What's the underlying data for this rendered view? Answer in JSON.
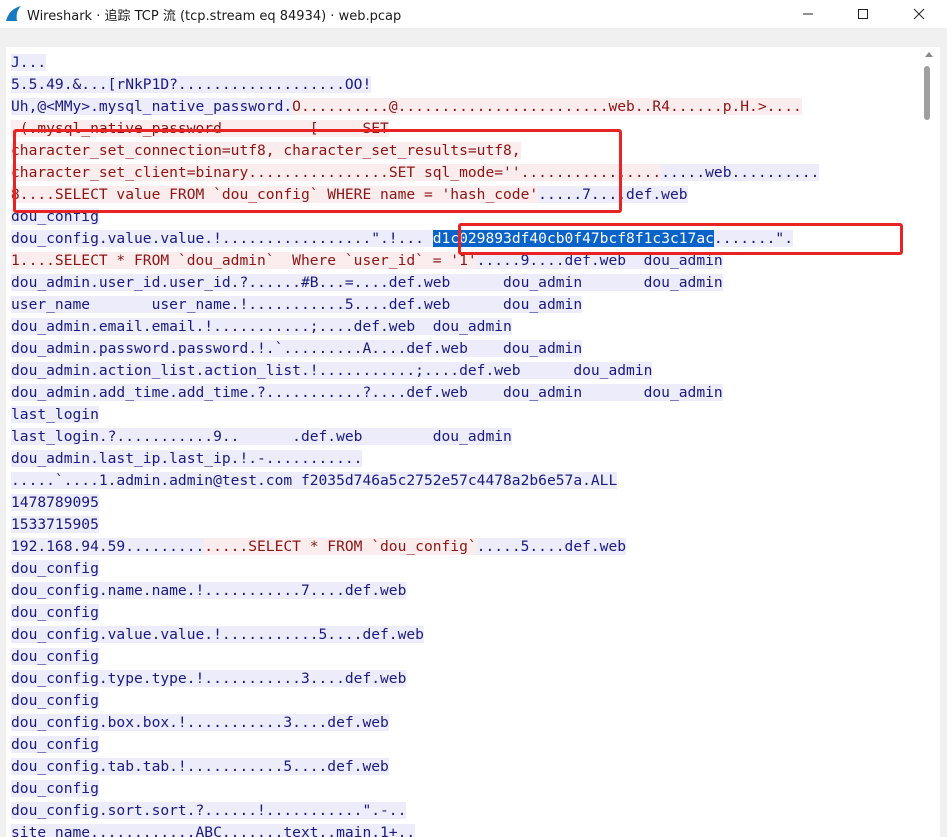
{
  "window": {
    "title": "Wireshark · 追踪 TCP 流 (tcp.stream eq 84934) · web.pcap",
    "buttons": {
      "minimize": "minimize-icon",
      "maximize": "maximize-icon",
      "close": "close-icon"
    }
  },
  "colors": {
    "client_bg": "#fbeded",
    "client_fg": "#8c1414",
    "server_bg": "#ececfa",
    "server_fg": "#1a1a80",
    "selection": "#0a63c8",
    "annotation": "#e82323"
  },
  "stream": {
    "lines": [
      [
        {
          "t": "J...",
          "k": "s"
        }
      ],
      [
        {
          "t": "5.5.49.&...[rNkP1D?...................OO!",
          "k": "s"
        }
      ],
      [
        {
          "t": "Uh,@<MMy>.mysql_native_password.",
          "k": "s"
        },
        {
          "t": "O..........@........................web..R4......p.H.>....",
          "k": "c"
        }
      ],
      [
        {
          "t": ".(.mysql_native_password",
          "k": "c"
        },
        {
          "t": "          ",
          "k": "c"
        },
        {
          "t": "[",
          "k": "c"
        },
        {
          "t": "     SET",
          "k": "c"
        }
      ],
      [
        {
          "t": "character_set_connection=utf8, character_set_results=utf8,",
          "k": "c"
        }
      ],
      [
        {
          "t": "character_set_client=binary",
          "k": "c"
        },
        {
          "t": "................SET sql_mode=''",
          "k": "c"
        },
        {
          "t": "................",
          "k": "c"
        },
        {
          "t": ".....web..........",
          "k": "s"
        }
      ],
      [
        {
          "t": "8....SELECT value FROM `dou_config` WHERE name = 'hash_code'",
          "k": "c"
        },
        {
          "t": ".....7....def.web",
          "k": "s"
        }
      ],
      [
        {
          "t": "dou_config",
          "k": "s"
        }
      ],
      [
        {
          "t": "dou_config.value.value.!.................\".!... ",
          "k": "s"
        },
        {
          "t": "d1c029893df40cb0f47bcf8f1c3c17ac",
          "k": "sel"
        },
        {
          "t": ".......\".",
          "k": "s"
        }
      ],
      [
        {
          "t": "1....SELECT * FROM `dou_admin`  Where `user_id` = '1'",
          "k": "c"
        },
        {
          "t": ".....9....def.web  dou_admin",
          "k": "s"
        }
      ],
      [
        {
          "t": "dou_admin.user_id.user_id.?......#B...=....def.web      dou_admin       dou_admin",
          "k": "s"
        }
      ],
      [
        {
          "t": "user_name       user_name.!...........5....def.web      dou_admin",
          "k": "s"
        }
      ],
      [
        {
          "t": "dou_admin.email.email.!...........;....def.web  dou_admin",
          "k": "s"
        }
      ],
      [
        {
          "t": "dou_admin.password.password.!.`.........A....def.web    dou_admin",
          "k": "s"
        }
      ],
      [
        {
          "t": "dou_admin.action_list.action_list.!...........;....def.web      dou_admin",
          "k": "s"
        }
      ],
      [
        {
          "t": "dou_admin.add_time.add_time.?...........?....def.web    dou_admin       dou_admin",
          "k": "s"
        }
      ],
      [
        {
          "t": "last_login",
          "k": "s"
        }
      ],
      [
        {
          "t": "last_login.?...........9..      .def.web        dou_admin",
          "k": "s"
        }
      ],
      [
        {
          "t": "dou_admin.last_ip.last_ip.!.-...........",
          "k": "s"
        }
      ],
      [
        {
          "t": ".....`....1.admin.admin@test.com f2035d746a5c2752e57c4478a2b6e57a.ALL",
          "k": "s"
        }
      ],
      [
        {
          "t": "1478789095",
          "k": "s"
        }
      ],
      [
        {
          "t": "1533715905",
          "k": "s"
        }
      ],
      [
        {
          "t": "192.168.94.59.........",
          "k": "s"
        },
        {
          "t": ".....SELECT * FROM `dou_config`",
          "k": "c"
        },
        {
          "t": ".....5....def.web",
          "k": "s"
        }
      ],
      [
        {
          "t": "dou_config",
          "k": "s"
        }
      ],
      [
        {
          "t": "dou_config.name.name.!...........7....def.web",
          "k": "s"
        }
      ],
      [
        {
          "t": "dou_config",
          "k": "s"
        }
      ],
      [
        {
          "t": "dou_config.value.value.!...........5....def.web",
          "k": "s"
        }
      ],
      [
        {
          "t": "dou_config",
          "k": "s"
        }
      ],
      [
        {
          "t": "dou_config.type.type.!...........3....def.web",
          "k": "s"
        }
      ],
      [
        {
          "t": "dou_config",
          "k": "s"
        }
      ],
      [
        {
          "t": "dou_config.box.box.!...........3....def.web",
          "k": "s"
        }
      ],
      [
        {
          "t": "dou_config",
          "k": "s"
        }
      ],
      [
        {
          "t": "dou_config.tab.tab.!...........5....def.web",
          "k": "s"
        }
      ],
      [
        {
          "t": "dou_config",
          "k": "s"
        }
      ],
      [
        {
          "t": "dou_config.sort.sort.?......!...........\".-..",
          "k": "s"
        }
      ],
      [
        {
          "t": "site_name............ABC.......text..main.1+..",
          "k": "s"
        }
      ]
    ]
  }
}
